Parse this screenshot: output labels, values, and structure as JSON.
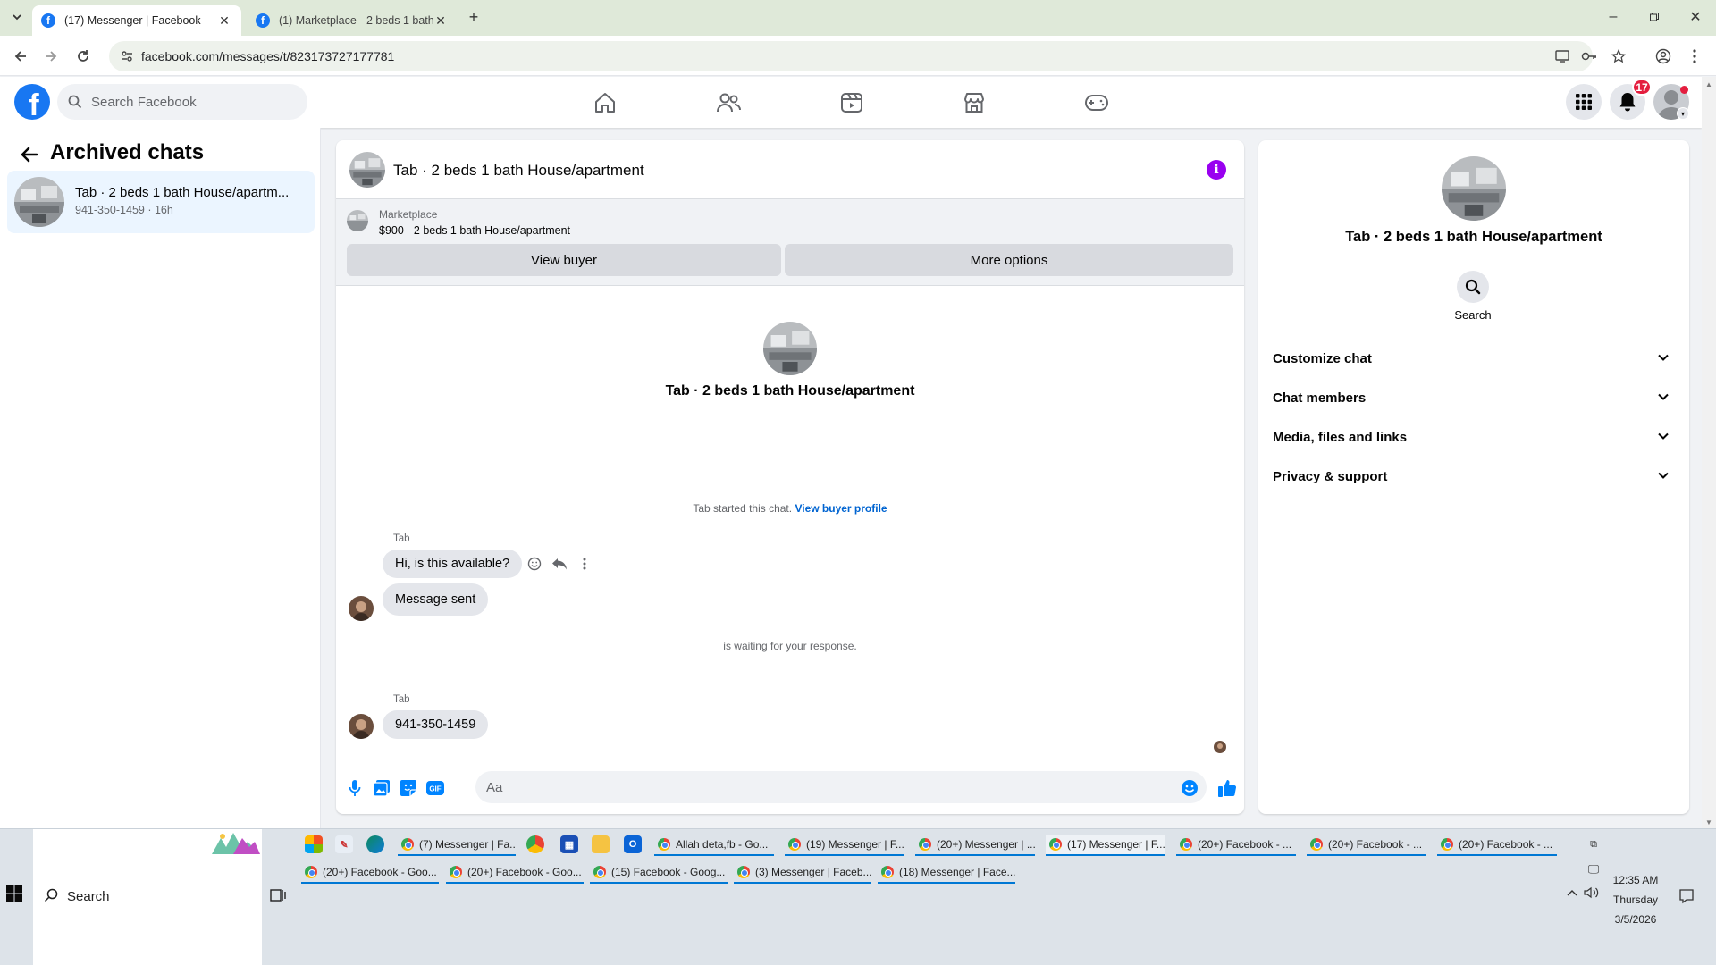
{
  "browser": {
    "tabs": [
      {
        "title": "(17) Messenger | Facebook",
        "active": true
      },
      {
        "title": "(1) Marketplace - 2 beds 1 bath",
        "active": false
      }
    ],
    "url": "facebook.com/messages/t/823173727177781"
  },
  "fbnav": {
    "search_placeholder": "Search Facebook",
    "notification_count": "17"
  },
  "left": {
    "title": "Archived chats",
    "chat": {
      "name": "Tab · 2 beds 1 bath House/apartm...",
      "subtitle": "941-350-1459 · 16h"
    }
  },
  "conversation": {
    "header_title": "Tab · 2 beds 1 bath House/apartment",
    "marketplace_label": "Marketplace",
    "marketplace_item": "$900 - 2 beds 1 bath House/apartment",
    "view_buyer_label": "View buyer",
    "more_options_label": "More options",
    "intro_title": "Tab · 2 beds 1 bath House/apartment",
    "started_text": "Tab started this chat.",
    "started_link": "View buyer profile",
    "messages": [
      {
        "sender": "Tab",
        "text": "Hi, is this available?"
      },
      {
        "text": "Message sent"
      },
      {
        "sender": "Tab",
        "text": "941-350-1459"
      }
    ],
    "waiting_text": "is waiting for your response.",
    "input_placeholder": "Aa"
  },
  "right": {
    "title": "Tab · 2 beds 1 bath House/apartment",
    "search_label": "Search",
    "sections": [
      "Customize chat",
      "Chat members",
      "Media, files and links",
      "Privacy & support"
    ]
  },
  "taskbar": {
    "search_label": "Search",
    "windows_row1": [
      "(7) Messenger | Fa...",
      "Allah deta,fb - Go...",
      "(19) Messenger | F...",
      "(20+) Messenger | ...",
      "(17) Messenger | F...",
      "(20+) Facebook - ...",
      "(20+) Facebook - ...",
      "(20+) Facebook - ..."
    ],
    "windows_row2": [
      "(20+) Facebook - Goo...",
      "(20+) Facebook - Goo...",
      "(15) Facebook - Goog...",
      "(3) Messenger | Faceb...",
      "(18) Messenger | Face..."
    ],
    "time": "12:35 AM",
    "day": "Thursday",
    "date": "3/5/2026"
  },
  "colors": {
    "fb_blue": "#1877f2",
    "messenger_blue": "#0084ff",
    "info_purple": "#9900f0",
    "badge_red": "#e41e3f",
    "chrome_green": "#dfe9d9"
  }
}
